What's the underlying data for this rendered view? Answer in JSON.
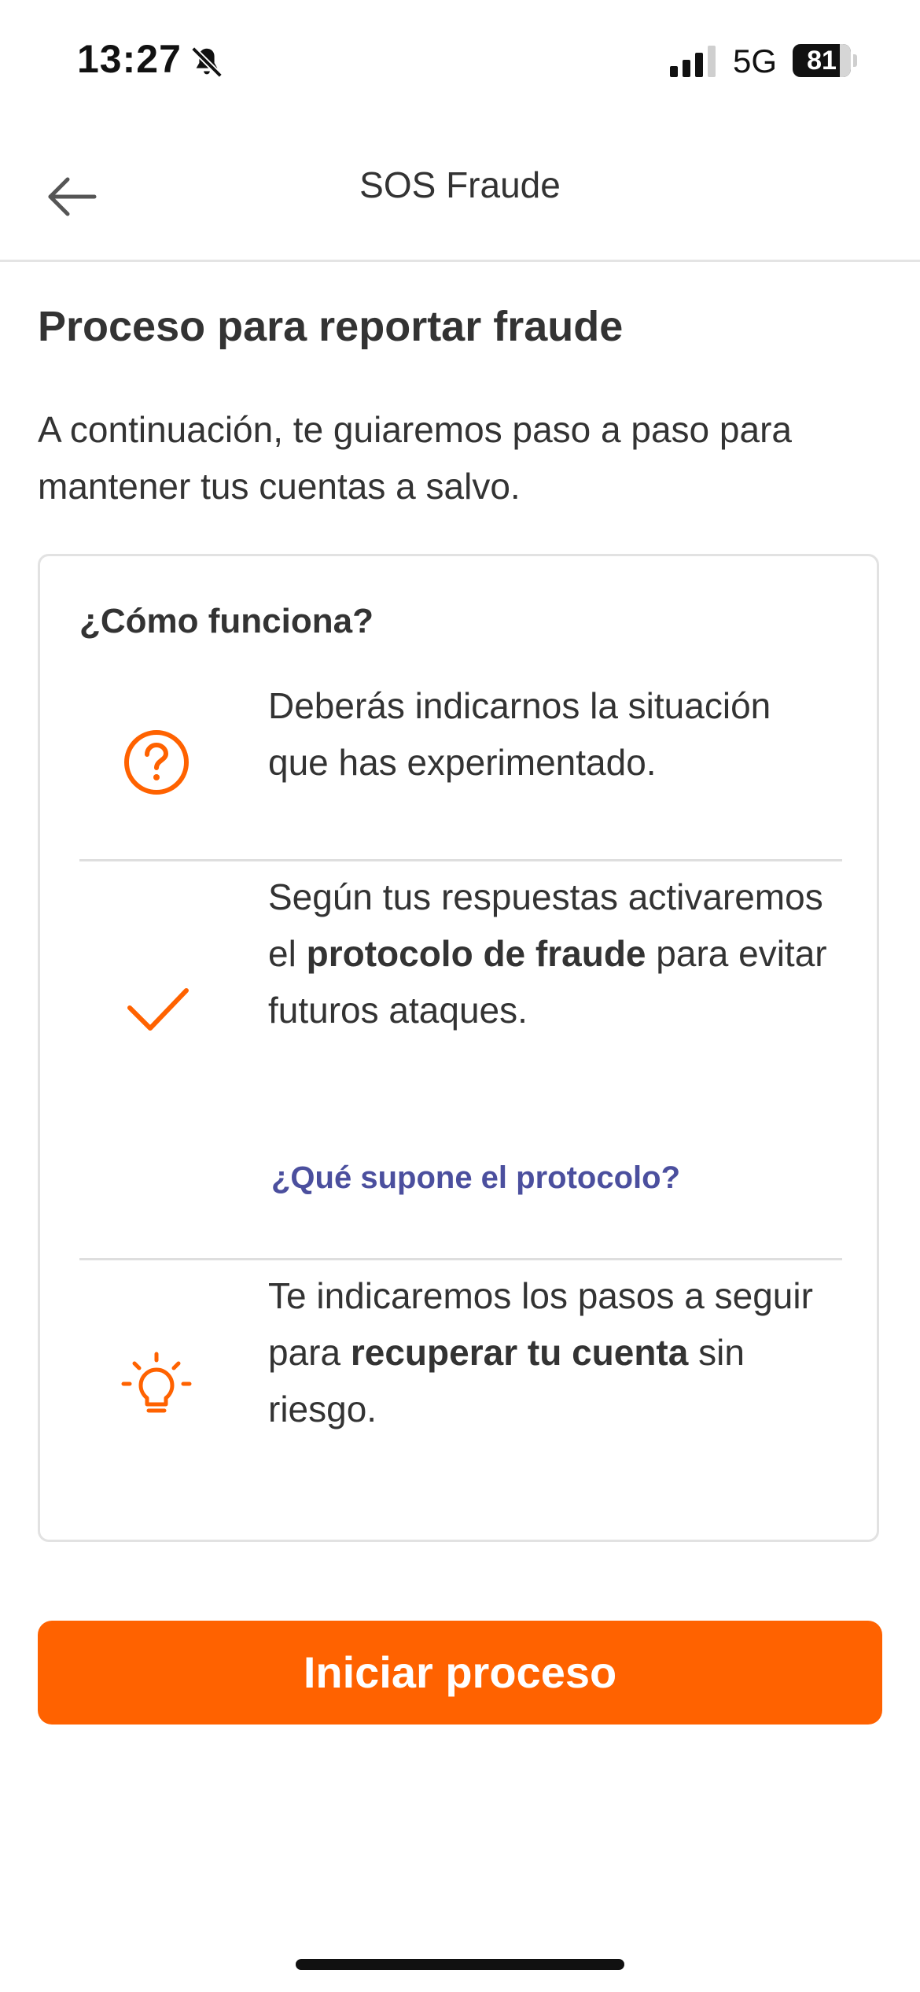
{
  "status_bar": {
    "time": "13:27",
    "silent_icon": "bell-slash-icon",
    "signal_icon": "cellular-signal-icon",
    "network": "5G",
    "battery_level": "81",
    "battery_fraction": 0.81
  },
  "nav": {
    "back_icon": "arrow-left-icon",
    "title": "SOS Fraude"
  },
  "page": {
    "title": "Proceso para reportar fraude",
    "intro": "A continuación, te guiaremos paso a paso para mantener tus cuentas a salvo."
  },
  "card": {
    "title": "¿Cómo funciona?",
    "steps": [
      {
        "icon": "question-circle-icon",
        "text": "Deberás indicarnos la situación que has experimentado."
      },
      {
        "icon": "checkmark-icon",
        "text_1": "Según tus respuestas activaremos el ",
        "bold_1": "protocolo de fraude",
        "text_2": " para evitar futuros ataques.",
        "link": "¿Qué supone el protocolo?"
      },
      {
        "icon": "lightbulb-icon",
        "text_1": "Te indicaremos los pasos a seguir para ",
        "bold_1": "recuperar tu cuenta",
        "text_2": " sin riesgo."
      }
    ]
  },
  "cta": {
    "label": "Iniciar proceso"
  },
  "colors": {
    "accent": "#ff6200",
    "link": "#4b4f9e",
    "text": "#333333"
  }
}
